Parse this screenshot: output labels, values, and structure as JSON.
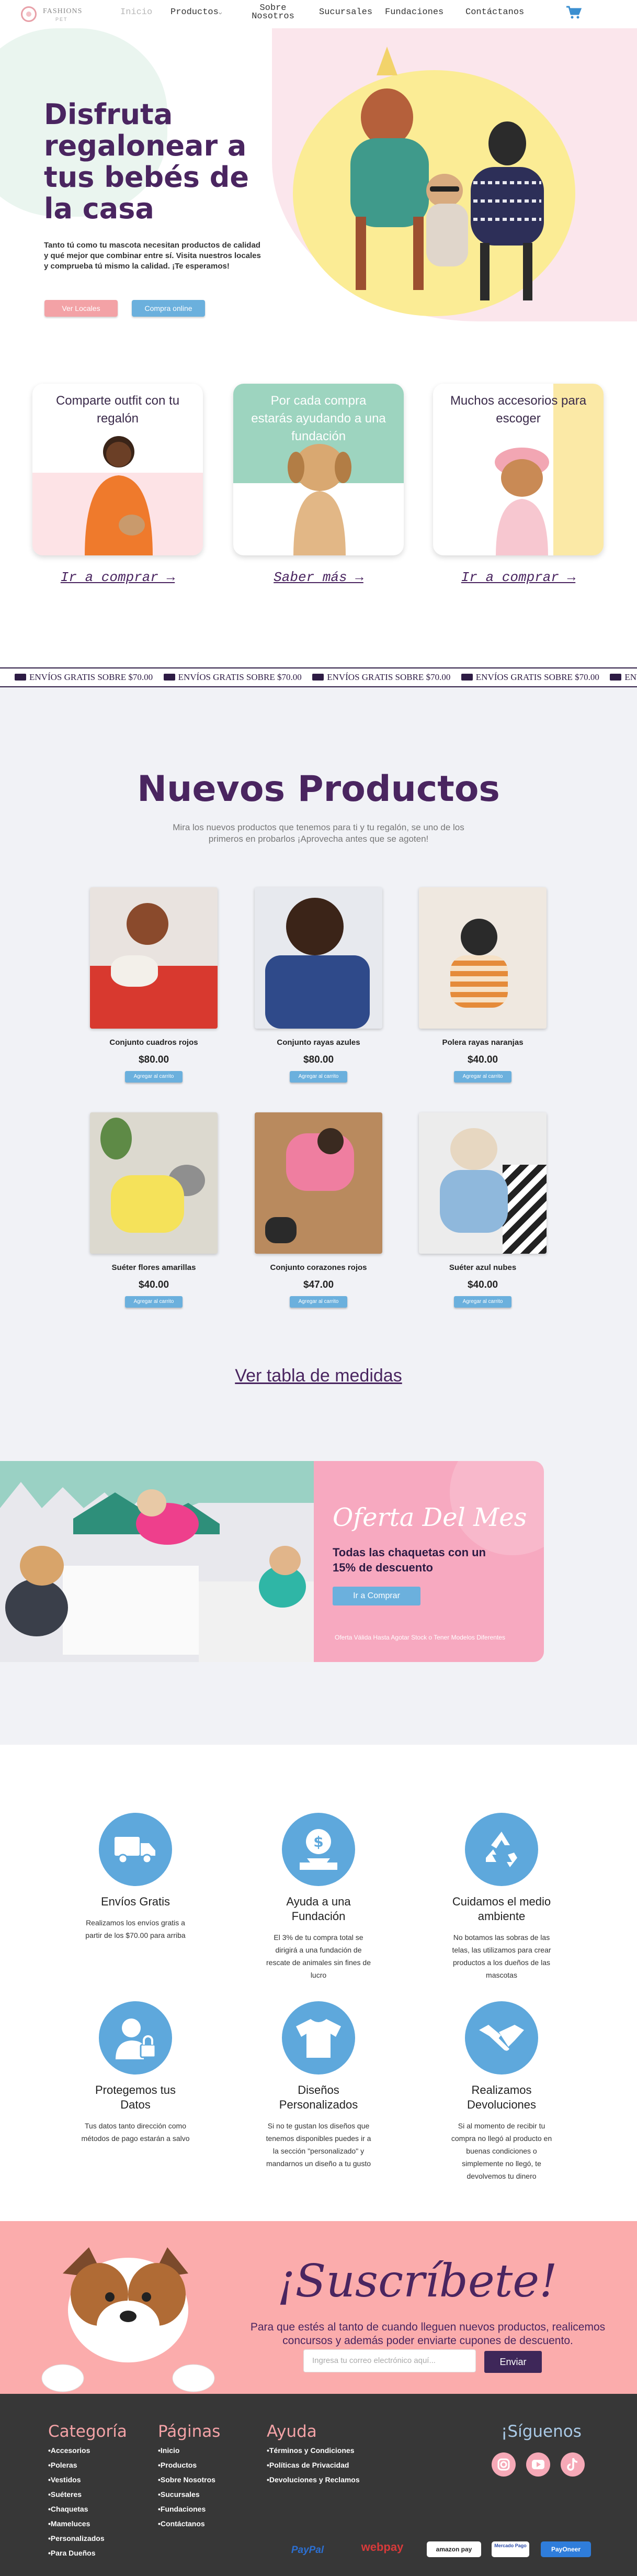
{
  "header": {
    "logo_line1": "FASHIONS",
    "logo_line2": "PET",
    "nav": [
      "Inicio",
      "Productos",
      "Sobre Nosotros",
      "Sucursales",
      "Fundaciones",
      "Contáctanos"
    ],
    "cart_icon": "shopping-cart-icon"
  },
  "hero": {
    "title": "Disfruta regalonear a tus bebés de la casa",
    "text": "Tanto tú como tu mascota necesitan productos de calidad y qué mejor que combinar entre sí. Visita nuestros locales y comprueba tú mismo la calidad. ¡Te esperamos!",
    "btn_locales": "Ver Locales",
    "btn_online": "Compra online"
  },
  "features": [
    {
      "caption": "Comparte outfit con tu regalón",
      "link": "Ir a comprar →",
      "bg": "#f8e5e8"
    },
    {
      "caption": "Por cada compra estarás ayudando a una fundación",
      "link": "Saber más →",
      "bg": "#9dd4bf"
    },
    {
      "caption": "Muchos accesorios para escoger",
      "link": "Ir a comprar →",
      "bg": "#fbe9a6"
    }
  ],
  "marquee": [
    "ENVÍOS GRATIS SOBRE $70.00",
    "ENVÍOS GRATIS SOBRE $70.00",
    "ENVÍOS GRATIS SOBRE $70.00",
    "ENVÍOS GRATIS SOBRE $70.00",
    "ENVÍOS GRATIS SOBRE $70.00"
  ],
  "products_section": {
    "title": "Nuevos Productos",
    "subtitle": "Mira los nuevos productos que tenemos para ti y tu regalón, se uno de los primeros en probarlos ¡Aprovecha antes que se agoten!",
    "add_label": "Agregar al carrito",
    "items": [
      {
        "name": "Conjunto cuadros rojos",
        "price": "$80.00"
      },
      {
        "name": "Conjunto rayas azules",
        "price": "$80.00"
      },
      {
        "name": "Polera rayas naranjas",
        "price": "$40.00"
      },
      {
        "name": "Suéter flores amarillas",
        "price": "$40.00"
      },
      {
        "name": "Conjunto corazones rojos",
        "price": "$47.00"
      },
      {
        "name": "Suéter azul nubes",
        "price": "$40.00"
      }
    ],
    "size_table_link": "Ver tabla de medidas"
  },
  "offer": {
    "title": "Oferta Del Mes",
    "text": "Todas las chaquetas con un 15% de descuento",
    "button": "Ir a Comprar",
    "note": "Oferta Válida Hasta Agotar Stock o Tener Modelos Diferentes"
  },
  "benefits": [
    {
      "title": "Envíos Gratis",
      "text": "Realizamos los envíos gratis a partir de los $70.00 para arriba",
      "icon": "truck-icon"
    },
    {
      "title": "Ayuda a una Fundación",
      "text": "El 3% de tu compra total se dirigirá a una fundación de rescate de animales sin fines de lucro",
      "icon": "donation-icon"
    },
    {
      "title": "Cuidamos el medio ambiente",
      "text": "No botamos las sobras de las telas, las utilizamos para crear productos a los dueños de las mascotas",
      "icon": "recycle-icon"
    },
    {
      "title": "Protegemos tus Datos",
      "text": "Tus datos tanto dirección como métodos de pago estarán a salvo",
      "icon": "user-lock-icon"
    },
    {
      "title": "Diseños Personalizados",
      "text": "Si no te gustan los diseños que tenemos disponibles puedes ir a la sección \"personalizado\" y mandarnos un diseño a tu gusto",
      "icon": "tshirt-icon"
    },
    {
      "title": "Realizamos Devoluciones",
      "text": "Si al momento de recibir tu compra no llegó al producto en buenas condiciones o simplemente no llegó, te devolvemos tu dinero",
      "icon": "handshake-icon"
    }
  ],
  "subscribe": {
    "title": "¡Suscríbete!",
    "text": "Para que estés al tanto de cuando lleguen nuevos productos, realicemos concursos y además poder enviarte cupones de descuento.",
    "placeholder": "Ingresa tu correo electrónico aquí...",
    "button": "Enviar"
  },
  "footer": {
    "categoria": {
      "title": "Categoría",
      "items": [
        "•Accesorios",
        "•Poleras",
        "•Vestidos",
        "•Suéteres",
        "•Chaquetas",
        "•Mameluces",
        "•Personalizados",
        "•Para Dueños"
      ]
    },
    "paginas": {
      "title": "Páginas",
      "items": [
        "•Inicio",
        "•Productos",
        "•Sobre Nosotros",
        "•Sucursales",
        "•Fundaciones",
        "•Contáctanos"
      ]
    },
    "ayuda": {
      "title": "Ayuda",
      "items": [
        "•Términos y Condiciones",
        "•Políticas de Privacidad",
        "•Devoluciones y Reclamos"
      ]
    },
    "siguenos": "¡Síguenos",
    "social_icons": [
      "instagram-icon",
      "youtube-icon",
      "tiktok-icon"
    ],
    "payments": [
      "PayPal",
      "webpay",
      "amazon pay",
      "Mercado Pago",
      "PayOneer"
    ]
  }
}
